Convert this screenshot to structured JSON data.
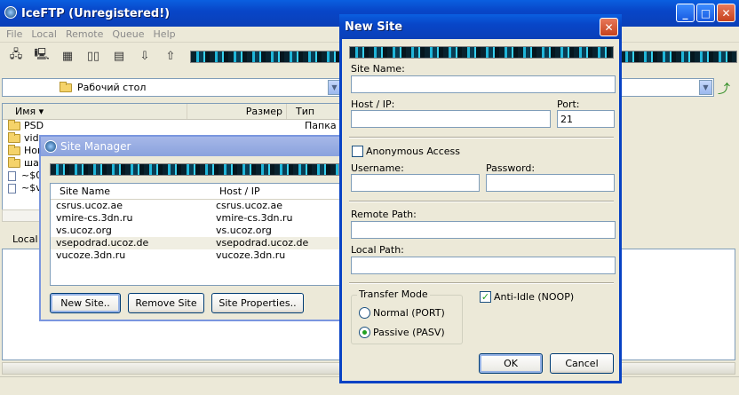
{
  "main": {
    "title": "IceFTP (Unregistered!)",
    "menu": [
      "File",
      "Local",
      "Remote",
      "Queue",
      "Help"
    ],
    "path": "Рабочий стол",
    "columns": {
      "name": "Имя",
      "size": "Размер",
      "type": "Тип"
    },
    "files": [
      {
        "name": "PSD",
        "type": "Папка",
        "kind": "folder"
      },
      {
        "name": "vide",
        "type": "",
        "kind": "folder"
      },
      {
        "name": "Нов",
        "type": "",
        "kind": "folder"
      },
      {
        "name": "шаб",
        "type": "",
        "kind": "folder"
      },
      {
        "name": "~$0",
        "type": "",
        "kind": "doc"
      },
      {
        "name": "~$v",
        "type": "",
        "kind": "doc"
      }
    ],
    "local_tab": "Local"
  },
  "site_manager": {
    "title": "Site Manager",
    "col_name": "Site Name",
    "col_host": "Host / IP",
    "sites": [
      {
        "name": "csrus.ucoz.ae",
        "host": "csrus.ucoz.ae"
      },
      {
        "name": "vmire-cs.3dn.ru",
        "host": "vmire-cs.3dn.ru"
      },
      {
        "name": "vs.ucoz.org",
        "host": "vs.ucoz.org"
      },
      {
        "name": "vsepodrad.ucoz.de",
        "host": "vsepodrad.ucoz.de"
      },
      {
        "name": "vucoze.3dn.ru",
        "host": "vucoze.3dn.ru"
      }
    ],
    "selected_index": 3,
    "buttons": {
      "new": "New Site..",
      "remove": "Remove Site",
      "properties": "Site Properties.."
    }
  },
  "new_site": {
    "title": "New Site",
    "site_name_label": "Site Name:",
    "site_name_value": "",
    "host_label": "Host / IP:",
    "host_value": "",
    "port_label": "Port:",
    "port_value": "21",
    "anonymous_label": "Anonymous Access",
    "anonymous_checked": false,
    "username_label": "Username:",
    "username_value": "",
    "password_label": "Password:",
    "password_value": "",
    "remote_path_label": "Remote Path:",
    "remote_path_value": "",
    "local_path_label": "Local Path:",
    "local_path_value": "",
    "transfer_mode_label": "Transfer Mode",
    "mode_normal": "Normal (PORT)",
    "mode_passive": "Passive (PASV)",
    "selected_mode": "passive",
    "anti_idle_label": "Anti-Idle (NOOP)",
    "anti_idle_checked": true,
    "ok_label": "OK",
    "cancel_label": "Cancel"
  }
}
